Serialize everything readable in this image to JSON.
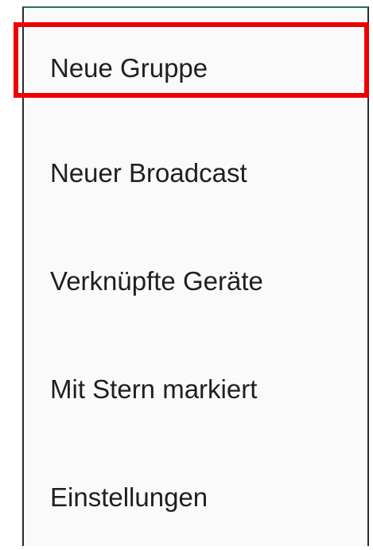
{
  "menu": {
    "items": [
      {
        "label": "Neue Gruppe",
        "highlighted": true
      },
      {
        "label": "Neuer Broadcast",
        "highlighted": false
      },
      {
        "label": "Verknüpfte Geräte",
        "highlighted": false
      },
      {
        "label": "Mit Stern markiert",
        "highlighted": false
      },
      {
        "label": "Einstellungen",
        "highlighted": false
      }
    ]
  },
  "colors": {
    "highlight": "#ee0000",
    "menu_background": "#fafafa",
    "text": "#1f1f1f",
    "top_bar": "#2f6f5c"
  }
}
